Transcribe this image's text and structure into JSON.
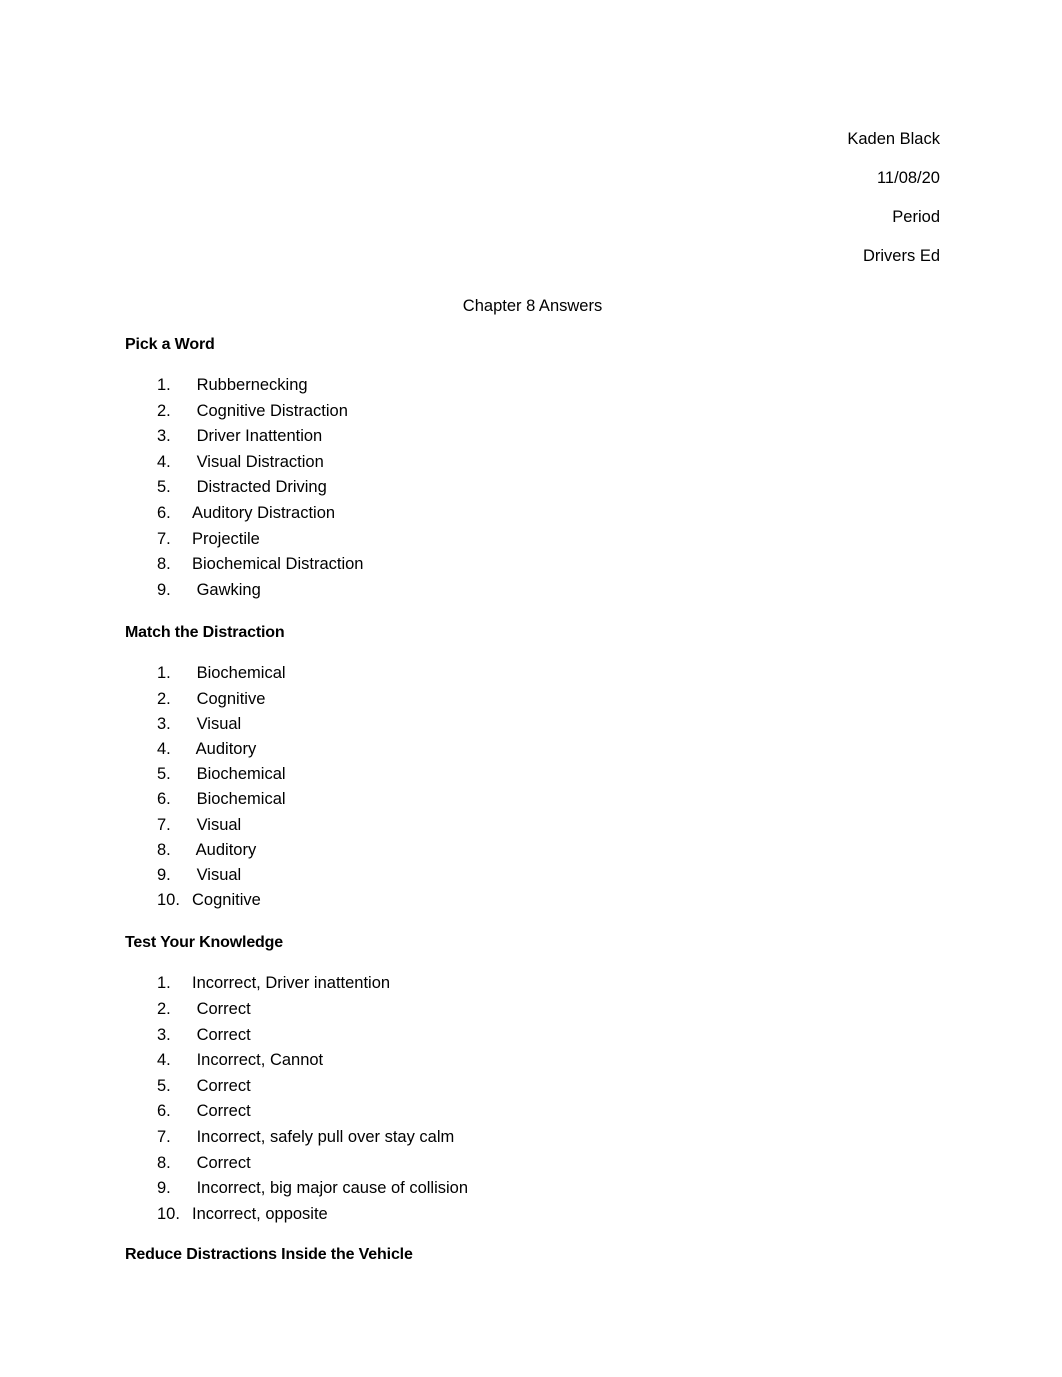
{
  "document": {
    "header_lines": [
      "Kaden Black",
      "11/08/20",
      "Period",
      "Drivers Ed"
    ],
    "title": "Chapter 8 Answers",
    "sections": [
      {
        "heading": "Pick a Word",
        "items": [
          {
            "number": "1.",
            "text": " Rubbernecking"
          },
          {
            "number": "2.",
            "text": " Cognitive Distraction"
          },
          {
            "number": "3.",
            "text": " Driver Inattention"
          },
          {
            "number": "4.",
            "text": " Visual Distraction"
          },
          {
            "number": "5.",
            "text": " Distracted Driving"
          },
          {
            "number": "6.",
            "text": "Auditory Distraction"
          },
          {
            "number": "7.",
            "text": "Projectile"
          },
          {
            "number": "8.",
            "text": "Biochemical Distraction"
          },
          {
            "number": "9.",
            "text": " Gawking"
          }
        ]
      },
      {
        "heading": "Match the Distraction",
        "items": [
          {
            "number": "1.",
            "text": " Biochemical"
          },
          {
            "number": "2.",
            "text": " Cognitive"
          },
          {
            "number": "3.",
            "text": " Visual"
          },
          {
            "number": "4.",
            "text": " Auditory"
          },
          {
            "number": "5.",
            "text": " Biochemical"
          },
          {
            "number": "6.",
            "text": " Biochemical"
          },
          {
            "number": "7.",
            "text": " Visual"
          },
          {
            "number": "8.",
            "text": " Auditory"
          },
          {
            "number": "9.",
            "text": " Visual"
          },
          {
            "number": "10.",
            "text": "Cognitive"
          }
        ]
      },
      {
        "heading": "Test Your Knowledge",
        "items": [
          {
            "number": "1.",
            "text": "Incorrect, Driver inattention"
          },
          {
            "number": "2.",
            "text": " Correct"
          },
          {
            "number": "3.",
            "text": " Correct"
          },
          {
            "number": "4.",
            "text": " Incorrect, Cannot"
          },
          {
            "number": "5.",
            "text": " Correct"
          },
          {
            "number": "6.",
            "text": " Correct"
          },
          {
            "number": "7.",
            "text": " Incorrect, safely pull over stay calm"
          },
          {
            "number": "8.",
            "text": " Correct"
          },
          {
            "number": "9.",
            "text": " Incorrect, big major cause of collision"
          },
          {
            "number": "10.",
            "text": "Incorrect, opposite"
          }
        ]
      },
      {
        "heading": "Reduce Distractions Inside the Vehicle",
        "items": []
      }
    ]
  }
}
